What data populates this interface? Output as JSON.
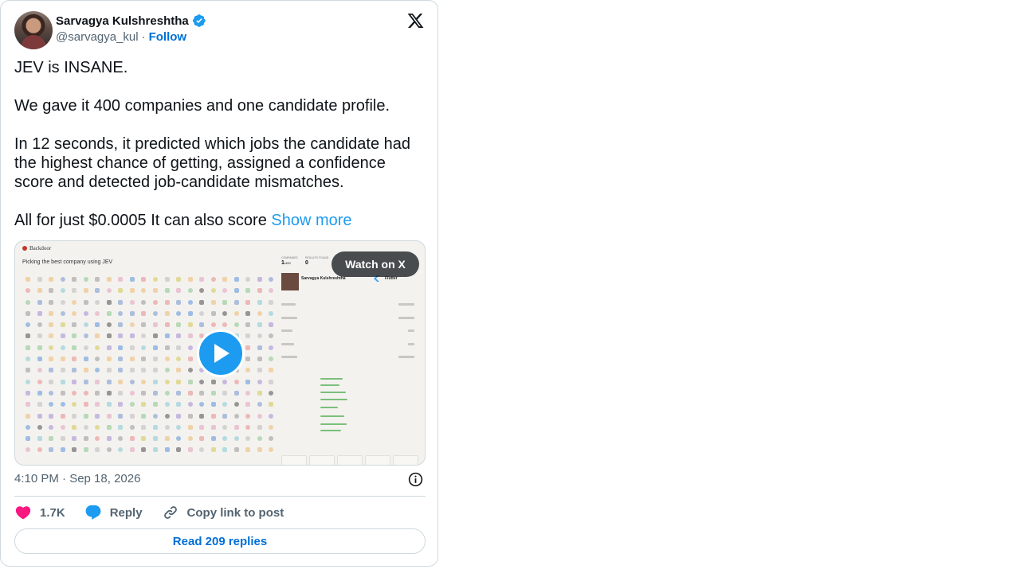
{
  "author": {
    "display_name": "Sarvagya Kulshreshtha",
    "handle": "@sarvagya_kul",
    "separator": "·",
    "follow_label": "Follow",
    "verified": true
  },
  "tweet": {
    "text": "JEV is INSANE.\n\nWe gave it 400 companies and one candidate profile.\n\nIn 12 seconds, it predicted which jobs the candidate had the highest chance of getting, assigned a confidence score and detected job-candidate mismatches.\n\nAll for just $0.0005  It can also score ",
    "show_more_label": "Show more"
  },
  "media": {
    "logo_text": "Backdoor",
    "title": "Picking the best company using JEV",
    "watch_label": "Watch on X",
    "stats": {
      "companies_value": "1",
      "companies_suffix": "/400",
      "results_value": "0"
    },
    "profile_name": "Sarvagya Kulshreshtha",
    "company_name": "Flutter"
  },
  "meta": {
    "timestamp": "4:10 PM · Sep 18, 2026"
  },
  "actions": {
    "likes_count": "1.7K",
    "reply_label": "Reply",
    "copy_link_label": "Copy link to post"
  },
  "footer": {
    "read_replies_label": "Read 209 replies"
  },
  "colors": {
    "accent": "#1d9bf0",
    "link": "#006fd6",
    "like": "#f91880",
    "muted": "#536471",
    "border": "#cfd9de"
  }
}
